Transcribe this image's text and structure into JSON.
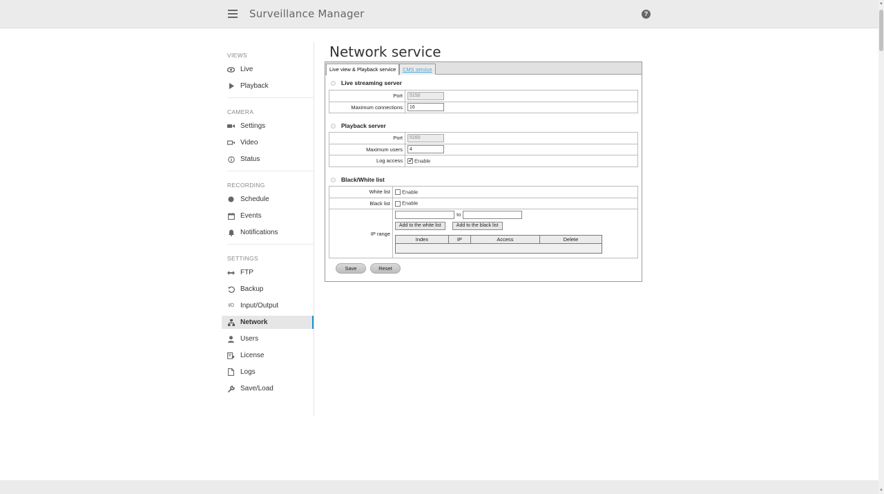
{
  "app": {
    "title": "Surveillance Manager"
  },
  "header": {
    "help_glyph": "?"
  },
  "sidebar": {
    "sections": [
      {
        "title": "VIEWS",
        "items": [
          {
            "label": "Live",
            "icon": "eye-icon"
          },
          {
            "label": "Playback",
            "icon": "play-icon"
          }
        ]
      },
      {
        "title": "CAMERA",
        "items": [
          {
            "label": "Settings",
            "icon": "camera-icon"
          },
          {
            "label": "Video",
            "icon": "video-icon"
          },
          {
            "label": "Status",
            "icon": "info-icon"
          }
        ]
      },
      {
        "title": "RECORDING",
        "items": [
          {
            "label": "Schedule",
            "icon": "record-icon"
          },
          {
            "label": "Events",
            "icon": "calendar-icon"
          },
          {
            "label": "Notifications",
            "icon": "bell-icon"
          }
        ]
      },
      {
        "title": "SETTINGS",
        "items": [
          {
            "label": "FTP",
            "icon": "transfer-icon"
          },
          {
            "label": "Backup",
            "icon": "backup-icon"
          },
          {
            "label": "Input/Output",
            "icon": "io-icon"
          },
          {
            "label": "Network",
            "icon": "network-icon",
            "active": true
          },
          {
            "label": "Users",
            "icon": "user-icon"
          },
          {
            "label": "License",
            "icon": "license-icon"
          },
          {
            "label": "Logs",
            "icon": "document-icon"
          },
          {
            "label": "Save/Load",
            "icon": "wrench-icon"
          }
        ]
      }
    ]
  },
  "main": {
    "title": "Network service",
    "tabs": [
      {
        "label": "Live view & Playback service",
        "active": true
      },
      {
        "label": "CMS service",
        "active": false
      }
    ],
    "live_streaming": {
      "title": "Live streaming server",
      "port_label": "Port",
      "port_value": "5150",
      "max_conn_label": "Maximum connections",
      "max_conn_value": "16"
    },
    "playback": {
      "title": "Playback server",
      "port_label": "Port",
      "port_value": "5160",
      "max_users_label": "Maximum users",
      "max_users_value": "4",
      "log_access_label": "Log access",
      "log_access_enable": "Enable",
      "log_access_checked": true
    },
    "bwlist": {
      "title": "Black/White list",
      "white_label": "White list",
      "white_enable": "Enable",
      "black_label": "Black list",
      "black_enable": "Enable",
      "ip_range_label": "IP range",
      "to_label": "to",
      "add_white_button": "Add to the white list",
      "add_black_button": "Add to the black list",
      "table_headers": [
        "Index",
        "IP",
        "Access",
        "Delete"
      ]
    },
    "save_button": "Save",
    "reset_button": "Reset"
  }
}
